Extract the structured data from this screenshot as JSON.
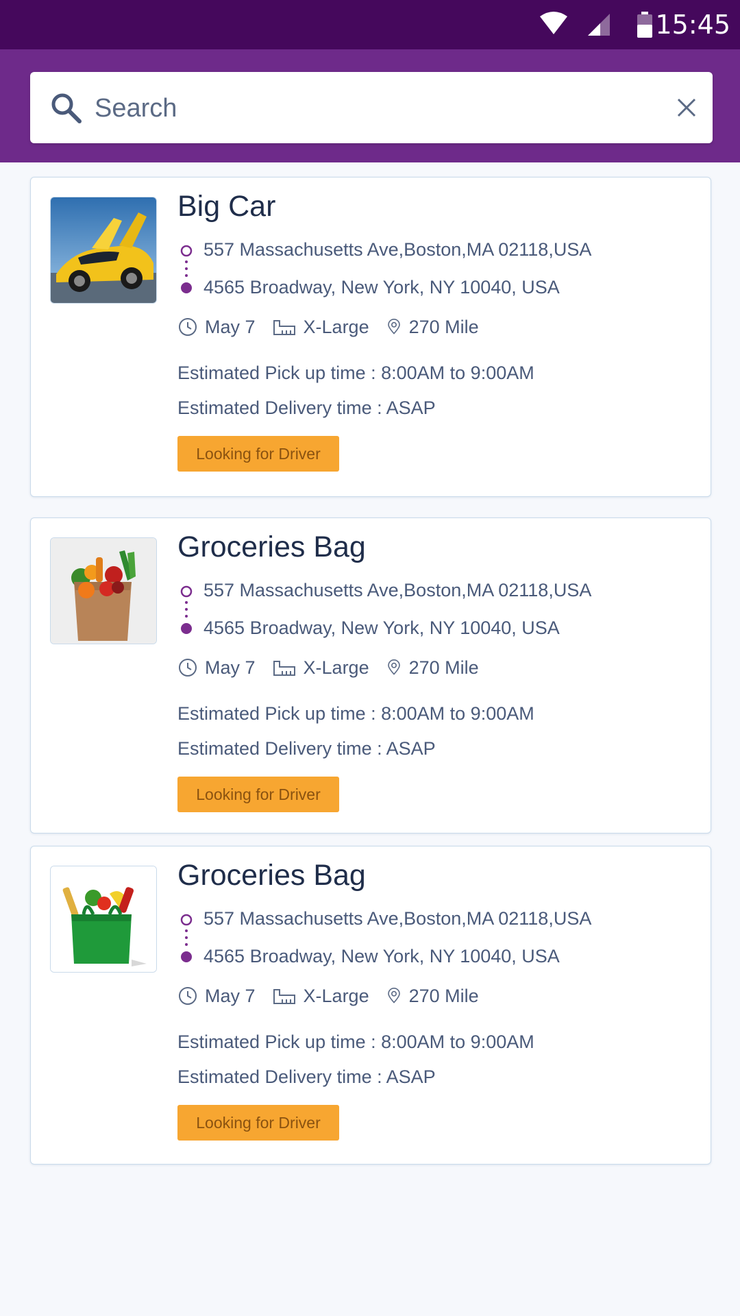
{
  "status_bar": {
    "time": "15:45"
  },
  "search": {
    "placeholder": "Search",
    "value": ""
  },
  "cards": [
    {
      "title": "Big Car",
      "image": "sports-car-image",
      "pickup_address": "557 Massachusetts Ave,Boston,MA 02118,USA",
      "dropoff_address": "4565 Broadway, New York, NY 10040, USA",
      "date": "May 7",
      "size": "X-Large",
      "distance": "270 Mile",
      "pickup_time": "Estimated Pick up time : 8:00AM to 9:00AM",
      "delivery_time": "Estimated Delivery time : ASAP",
      "status": "Looking for Driver"
    },
    {
      "title": "Groceries Bag",
      "image": "paper-grocery-bag-image",
      "pickup_address": "557 Massachusetts Ave,Boston,MA 02118,USA",
      "dropoff_address": "4565 Broadway, New York, NY 10040, USA",
      "date": "May 7",
      "size": "X-Large",
      "distance": "270 Mile",
      "pickup_time": "Estimated Pick up time : 8:00AM to 9:00AM",
      "delivery_time": "Estimated Delivery time : ASAP",
      "status": "Looking for Driver"
    },
    {
      "title": "Groceries Bag",
      "image": "green-grocery-bag-image",
      "pickup_address": "557 Massachusetts Ave,Boston,MA 02118,USA",
      "dropoff_address": "4565 Broadway, New York, NY 10040, USA",
      "date": "May 7",
      "size": "X-Large",
      "distance": "270 Mile",
      "pickup_time": "Estimated Pick up time : 8:00AM to 9:00AM",
      "delivery_time": "Estimated Delivery time : ASAP",
      "status": "Looking for Driver"
    }
  ],
  "colors": {
    "status_bar": "#45085c",
    "header": "#6e2a8a",
    "accent_purple": "#7b2d8e",
    "status_button": "#f7a631",
    "background": "#f6f8fc"
  }
}
